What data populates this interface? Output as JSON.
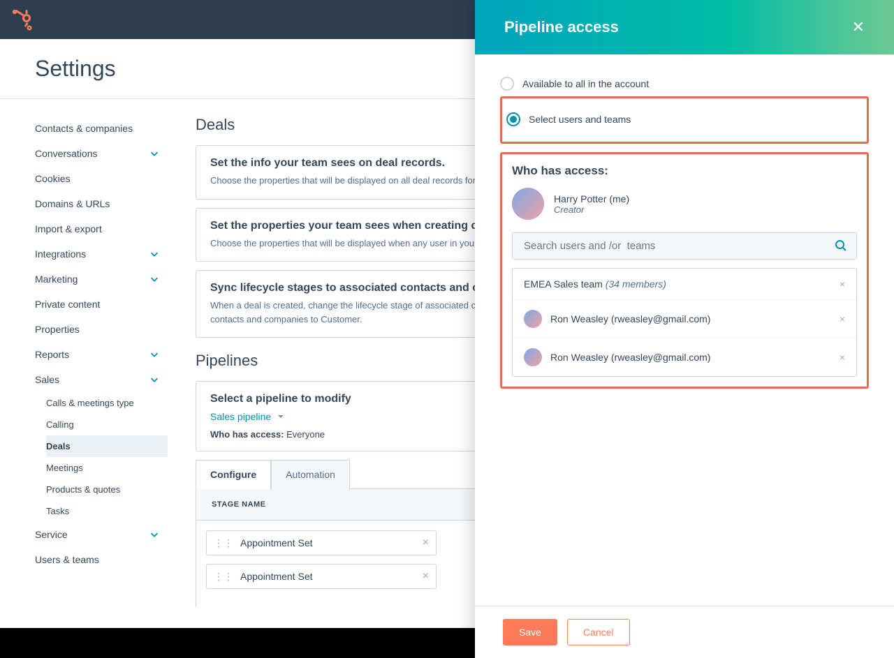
{
  "page": {
    "title": "Settings"
  },
  "sidebar": {
    "items": [
      {
        "label": "Contacts & companies",
        "expandable": false
      },
      {
        "label": "Conversations",
        "expandable": true
      },
      {
        "label": "Cookies",
        "expandable": false
      },
      {
        "label": "Domains & URLs",
        "expandable": false
      },
      {
        "label": "Import & export",
        "expandable": false
      },
      {
        "label": "Integrations",
        "expandable": true
      },
      {
        "label": "Marketing",
        "expandable": true
      },
      {
        "label": "Private content",
        "expandable": false
      },
      {
        "label": "Properties",
        "expandable": false
      },
      {
        "label": "Reports",
        "expandable": true
      },
      {
        "label": "Sales",
        "expandable": true
      },
      {
        "label": "Service",
        "expandable": true
      },
      {
        "label": "Users & teams",
        "expandable": false
      }
    ],
    "salesSub": [
      {
        "label": "Calls & meetings type"
      },
      {
        "label": "Calling"
      },
      {
        "label": "Deals",
        "active": true
      },
      {
        "label": "Meetings"
      },
      {
        "label": "Products & quotes"
      },
      {
        "label": "Tasks"
      }
    ]
  },
  "main": {
    "dealsHeading": "Deals",
    "cards": [
      {
        "title": "Set the info your team sees on deal records.",
        "body": "Choose the properties that will be displayed on all deal records for all users in your HubSpot account."
      },
      {
        "title": "Set the properties your team sees when creating deals.",
        "body": "Choose the properties that will be displayed when any user in your HubSpot account creates a deal, and which of those are required in order to create a deal."
      },
      {
        "title": "Sync lifecycle stages to associated contacts and companies",
        "body": "When a deal is created, change the lifecycle stage of associated contacts and companies to Opportunity. When a deal is won, change the lifecycle stage of associated contacts and companies to Customer."
      }
    ],
    "pipelinesHeading": "Pipelines",
    "pipelineSelect": {
      "label": "Select a pipeline to modify",
      "selected": "Sales pipeline",
      "whoLabel": "Who has access:",
      "whoValue": "Everyone"
    },
    "tabs": {
      "configure": "Configure",
      "automation": "Automation"
    },
    "stageHeader": "STAGE NAME",
    "stages": [
      {
        "name": "Appointment Set"
      },
      {
        "name": "Appointment Set"
      }
    ]
  },
  "drawer": {
    "title": "Pipeline access",
    "radio": {
      "all": "Available to all in the account",
      "select": "Select users and teams"
    },
    "whoHeading": "Who has access:",
    "creator": {
      "name": "Harry Potter (me)",
      "role": "Creator"
    },
    "searchPlaceholder": "Search users and /or  teams",
    "accessList": [
      {
        "type": "team",
        "label": "EMEA Sales team ",
        "meta": "(34 members)"
      },
      {
        "type": "user",
        "label": "Ron Weasley (rweasley@gmail.com)"
      },
      {
        "type": "user",
        "label": "Ron Weasley (rweasley@gmail.com)"
      }
    ],
    "buttons": {
      "save": "Save",
      "cancel": "Cancel"
    }
  }
}
